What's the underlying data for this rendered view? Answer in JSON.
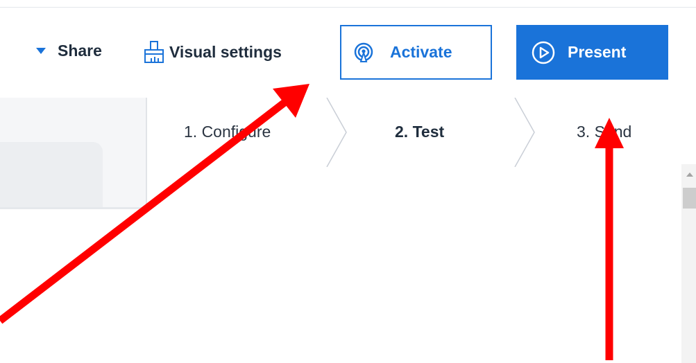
{
  "toolbar": {
    "share_label": "Share",
    "visual_settings_label": "Visual settings",
    "activate_label": "Activate",
    "present_label": "Present"
  },
  "steps": [
    {
      "label": "1. Configure"
    },
    {
      "label": "2. Test"
    },
    {
      "label": "3. Send"
    }
  ],
  "icons": {
    "share": "caret-down-icon",
    "visual_settings": "paintbrush-icon",
    "activate": "broadcast-icon",
    "present": "play-circle-icon"
  },
  "colors": {
    "accent": "#1a73d9",
    "annotation_arrow": "#ff0000"
  },
  "annotations": {
    "arrows": 2,
    "arrow_targets": [
      "Visual settings",
      "3. Send"
    ]
  }
}
